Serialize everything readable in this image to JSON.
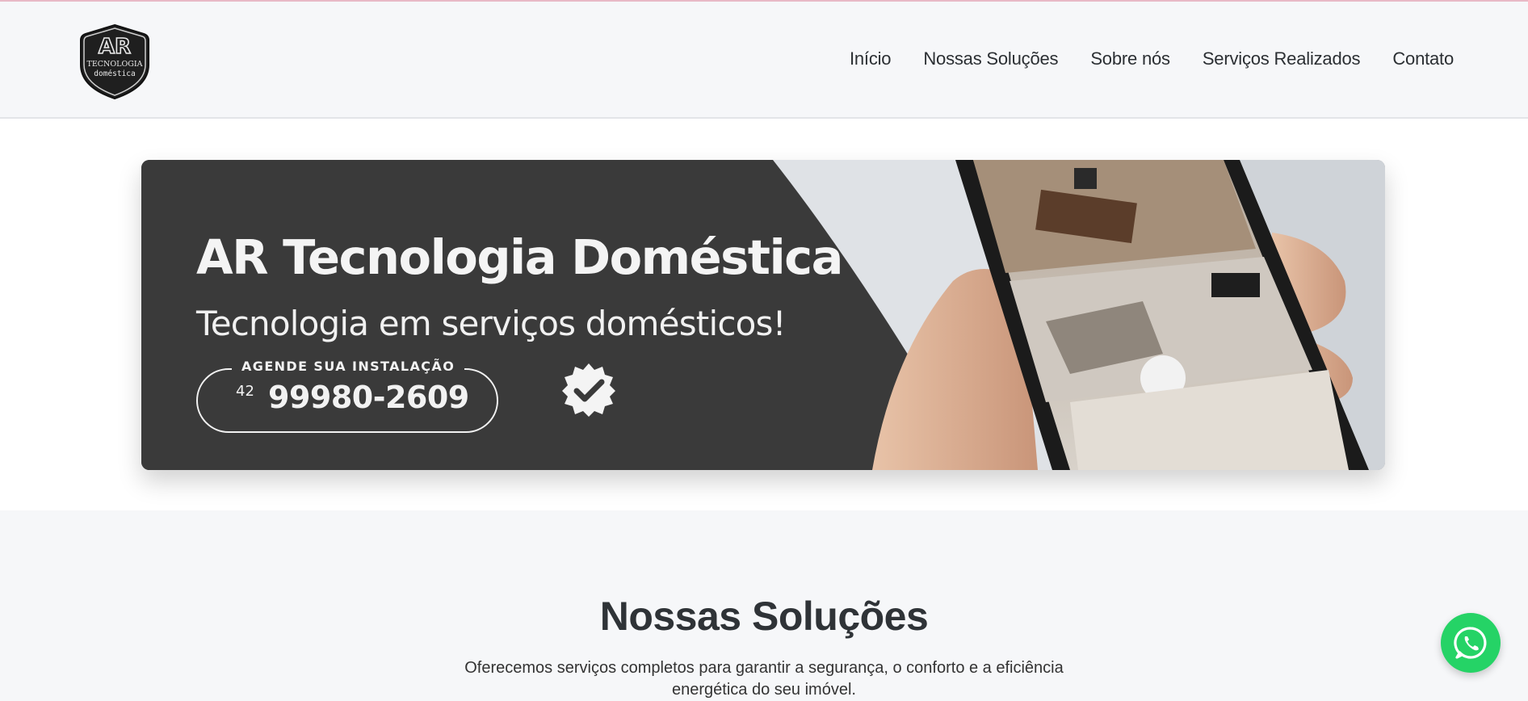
{
  "header": {
    "logo": {
      "line1": "AR",
      "line2": "TECNOLOGIA",
      "line3": "doméstica"
    },
    "nav": [
      {
        "label": "Início"
      },
      {
        "label": "Nossas Soluções"
      },
      {
        "label": "Sobre nós"
      },
      {
        "label": "Serviços Realizados"
      },
      {
        "label": "Contato"
      }
    ]
  },
  "banner": {
    "title": "AR Tecnologia Doméstica",
    "subtitle": "Tecnologia em serviços domésticos!",
    "cta_caption": "AGENDE SUA INSTALAÇÃO",
    "area_code": "42",
    "phone": "99980-2609"
  },
  "solutions": {
    "heading": "Nossas Soluções",
    "description": "Oferecemos serviços completos para garantir a segurança, o conforto e a eficiência energética do seu imóvel."
  },
  "whatsapp": {
    "icon": "whatsapp-icon",
    "color": "#25d366"
  },
  "colors": {
    "header_bg": "#f6f7f9",
    "banner_bg": "#3a3a3a",
    "text": "#2f3337"
  }
}
